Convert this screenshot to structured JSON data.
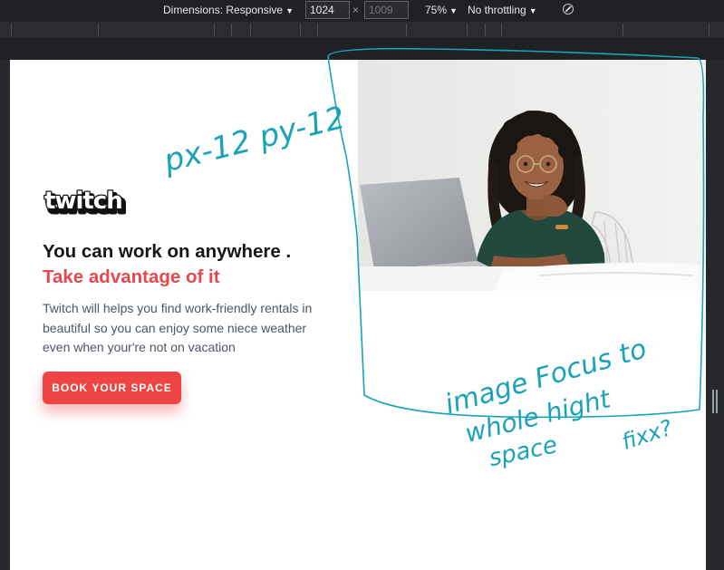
{
  "devtools": {
    "dimensions_label": "Dimensions: Responsive",
    "width": "1024",
    "height_placeholder": "1009",
    "times": "×",
    "zoom": "75%",
    "throttle": "No throttling"
  },
  "page": {
    "logo_text": "twitch",
    "headline": "You can work on anywhere .",
    "headline_accent": "Take advantage of it",
    "description": "Twitch will helps you find work-friendly rentals in beautiful so you can enjoy some niece weather even when your're not on vacation",
    "cta_label": "BOOK YOUR SPACE",
    "colors": {
      "accent": "#ef4444",
      "heading": "#161616",
      "body": "#4b5563"
    }
  },
  "annotations": [
    "px-12 py-12",
    "image Focus to",
    "whole hight",
    "space",
    "fixx?"
  ]
}
